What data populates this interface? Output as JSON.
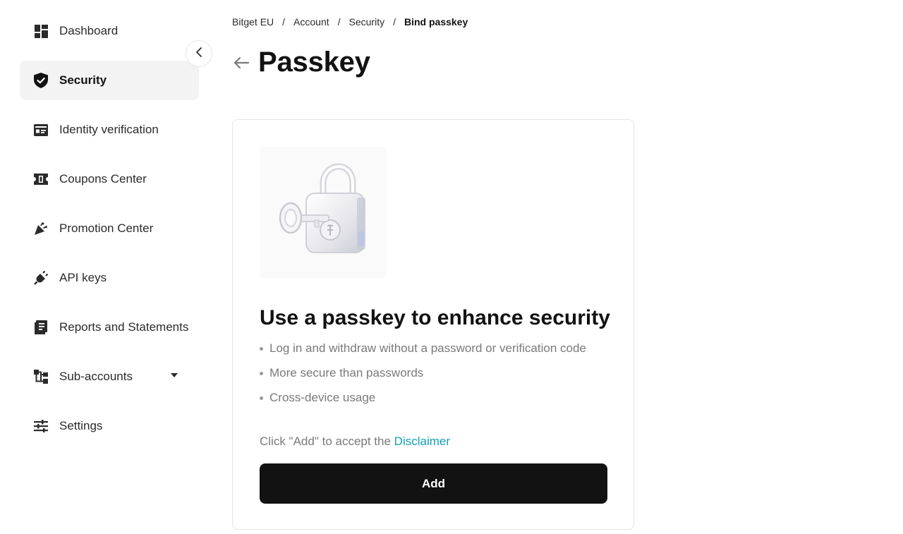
{
  "sidebar": {
    "items": [
      {
        "label": "Dashboard",
        "icon": "dashboard-icon"
      },
      {
        "label": "Security",
        "icon": "shield-icon",
        "active": true
      },
      {
        "label": "Identity verification",
        "icon": "id-card-icon"
      },
      {
        "label": "Coupons Center",
        "icon": "ticket-icon"
      },
      {
        "label": "Promotion Center",
        "icon": "party-popper-icon"
      },
      {
        "label": "API keys",
        "icon": "plug-icon"
      },
      {
        "label": "Reports and Statements",
        "icon": "document-icon"
      },
      {
        "label": "Sub-accounts",
        "icon": "hierarchy-icon",
        "expandable": true
      },
      {
        "label": "Settings",
        "icon": "sliders-icon"
      }
    ]
  },
  "breadcrumb": {
    "items": [
      "Bitget EU",
      "Account",
      "Security"
    ],
    "current": "Bind passkey",
    "separator": "/"
  },
  "page": {
    "title": "Passkey"
  },
  "card": {
    "heading": "Use a passkey to enhance security",
    "features": [
      "Log in and withdraw without a password or verification code",
      "More secure than passwords",
      "Cross-device usage"
    ],
    "disclaimer_prefix": "Click \"Add\" to accept the",
    "disclaimer_link": "Disclaimer",
    "add_label": "Add"
  },
  "colors": {
    "accent_link": "#14a1b8",
    "primary_button": "#121212",
    "active_nav_bg": "#f3f3f3"
  }
}
